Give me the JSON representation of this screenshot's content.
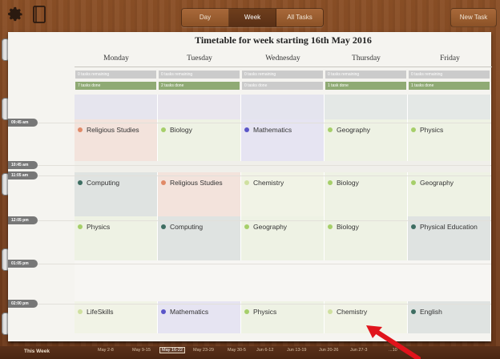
{
  "toolbar": {
    "gear_icon": "gear-icon",
    "notebook_icon": "notebook-icon",
    "view_tabs": [
      {
        "label": "Day",
        "active": false
      },
      {
        "label": "Week",
        "active": true
      },
      {
        "label": "All Tasks",
        "active": false
      }
    ],
    "new_task_label": "New Task"
  },
  "timetable": {
    "title": "Timetable for week starting 16th May 2016",
    "days": [
      {
        "name": "Monday",
        "remaining": "0 tasks remaining",
        "done": "7 tasks done"
      },
      {
        "name": "Tuesday",
        "remaining": "0 tasks remaining",
        "done": "2 tasks done"
      },
      {
        "name": "Wednesday",
        "remaining": "0 tasks remaining",
        "done": "0 tasks done"
      },
      {
        "name": "Thursday",
        "remaining": "0 tasks remaining",
        "done": "1 task done"
      },
      {
        "name": "Friday",
        "remaining": "0 tasks remaining",
        "done": "1 tasks done"
      }
    ],
    "times": [
      "09:45 am",
      "10:45 am",
      "11:05 am",
      "12:05 pm",
      "01:05 pm",
      "02:00 pm"
    ],
    "periods": [
      {
        "row": "p1",
        "lessons": [
          {
            "subject": "Religious Studies",
            "color": "#e08a68"
          },
          {
            "subject": "Biology",
            "color": "#a6cf6a"
          },
          {
            "subject": "Mathematics",
            "color": "#5a55c8"
          },
          {
            "subject": "Geography",
            "color": "#a6cf6a"
          },
          {
            "subject": "Physics",
            "color": "#a6cf6a"
          }
        ]
      },
      {
        "row": "p2",
        "lessons": [
          {
            "subject": "Computing",
            "color": "#3e6e62"
          },
          {
            "subject": "Religious Studies",
            "color": "#e08a68"
          },
          {
            "subject": "Chemistry",
            "color": "#cfe0a0"
          },
          {
            "subject": "Biology",
            "color": "#a6cf6a"
          },
          {
            "subject": "Geography",
            "color": "#a6cf6a"
          }
        ]
      },
      {
        "row": "p3",
        "lessons": [
          {
            "subject": "Physics",
            "color": "#a6cf6a"
          },
          {
            "subject": "Computing",
            "color": "#3e6e62"
          },
          {
            "subject": "Geography",
            "color": "#a6cf6a"
          },
          {
            "subject": "Biology",
            "color": "#a6cf6a"
          },
          {
            "subject": "Physical Education",
            "color": "#3e6e62"
          }
        ]
      },
      {
        "row": "p5",
        "lessons": [
          {
            "subject": "LifeSkills",
            "color": "#cfe0a0"
          },
          {
            "subject": "Mathematics",
            "color": "#5a55c8"
          },
          {
            "subject": "Physics",
            "color": "#a6cf6a"
          },
          {
            "subject": "Chemistry",
            "color": "#cfe0a0"
          },
          {
            "subject": "English",
            "color": "#3e6e62"
          }
        ]
      }
    ]
  },
  "week_bar": {
    "this_week_label": "This Week",
    "weeks": [
      {
        "label": "May 2-8",
        "selected": false
      },
      {
        "label": "May 9-15",
        "selected": false
      },
      {
        "label": "May 16-22",
        "selected": true
      },
      {
        "label": "May 23-29",
        "selected": false
      },
      {
        "label": "May 30-5",
        "selected": false
      },
      {
        "label": "Jun 6-12",
        "selected": false
      },
      {
        "label": "Jun 13-19",
        "selected": false
      },
      {
        "label": "Jun 20-26",
        "selected": false
      },
      {
        "label": "Jun 27-3",
        "selected": false
      },
      {
        "label": "...10",
        "selected": false
      }
    ]
  },
  "colors": {
    "wood": "#7a4220",
    "annotation_arrow": "#e0141c",
    "done_bar": "#8faa74",
    "remaining_bar": "#cbcbcb"
  }
}
